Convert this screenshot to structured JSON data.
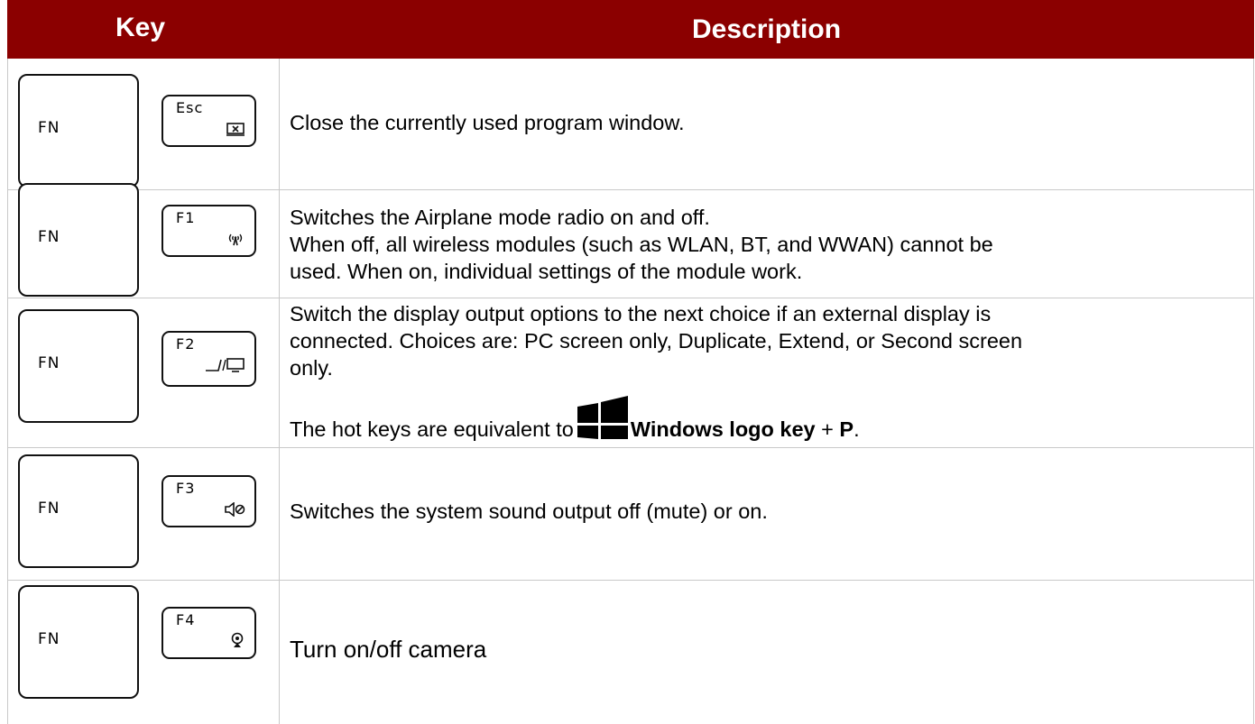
{
  "header": {
    "key": "Key",
    "description": "Description"
  },
  "rows": [
    {
      "fn": "FN",
      "fkey": "Esc",
      "icon": "close-window-icon",
      "description": "Close the currently used program window."
    },
    {
      "fn": "FN",
      "fkey": "F1",
      "icon": "airplane-radio-icon",
      "line1": "Switches the Airplane mode radio on and off.",
      "line2": "When off, all wireless modules (such as WLAN, BT, and WWAN) cannot be",
      "line3": "used. When on, individual settings of the module work."
    },
    {
      "fn": "FN",
      "fkey": "F2",
      "icon": "display-switch-icon",
      "line1": "Switch the display output options to the next choice if an external display is",
      "line2": "connected. Choices are: PC screen only, Duplicate, Extend, or Second screen",
      "line3": "only.",
      "hotkey_prefix": "The hot keys are equivalent to",
      "hotkey_win": "Windows logo key",
      "hotkey_plus": "+",
      "hotkey_p": "P",
      "hotkey_end": "."
    },
    {
      "fn": "FN",
      "fkey": "F3",
      "icon": "mute-icon",
      "description": "Switches the system sound output off (mute) or on."
    },
    {
      "fn": "FN",
      "fkey": "F4",
      "icon": "camera-icon",
      "description": "Turn on/off camera"
    }
  ],
  "colors": {
    "header_bg": "#8b0000",
    "header_text": "#ffffff",
    "grid": "#c9c9c9"
  }
}
